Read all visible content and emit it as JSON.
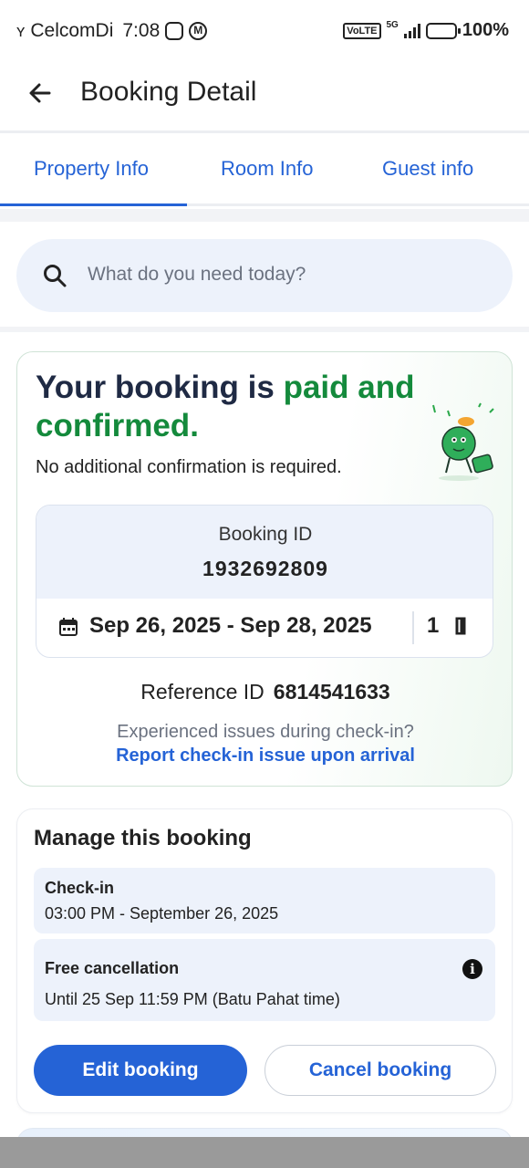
{
  "status_bar": {
    "carrier": "CelcomDi",
    "time": "7:08",
    "network_badge": "VoLTE",
    "network_type": "5G",
    "battery": "100%"
  },
  "header": {
    "title": "Booking Detail"
  },
  "tabs": [
    {
      "label": "Property Info",
      "active": true
    },
    {
      "label": "Room Info",
      "active": false
    },
    {
      "label": "Guest info",
      "active": false
    }
  ],
  "search": {
    "placeholder": "What do you need today?"
  },
  "confirmation": {
    "headline_part1": "Your booking is ",
    "headline_highlight": "paid and confirmed",
    "headline_end": ".",
    "subtext": "No additional confirmation is required.",
    "booking_id_label": "Booking ID",
    "booking_id": "1932692809",
    "dates": "Sep 26, 2025 - Sep 28, 2025",
    "nights": "1",
    "reference_label": "Reference ID",
    "reference_id": "6814541633",
    "issue_text": "Experienced issues during check-in?",
    "report_link": "Report check-in issue upon arrival"
  },
  "manage": {
    "title": "Manage this booking",
    "checkin_label": "Check-in",
    "checkin_value": "03:00 PM - September 26, 2025",
    "cancellation_label": "Free cancellation",
    "cancellation_value": "Until 25 Sep 11:59 PM (Batu Pahat time)",
    "edit_button": "Edit booking",
    "cancel_button": "Cancel booking"
  },
  "colors": {
    "primary_blue": "#2563d6",
    "confirmed_green": "#148a3c",
    "light_blue_bg": "#edf2fb"
  },
  "icons": [
    "back-arrow-icon",
    "search-icon",
    "calendar-icon",
    "moon-icon",
    "info-icon",
    "mascot-illustration"
  ]
}
